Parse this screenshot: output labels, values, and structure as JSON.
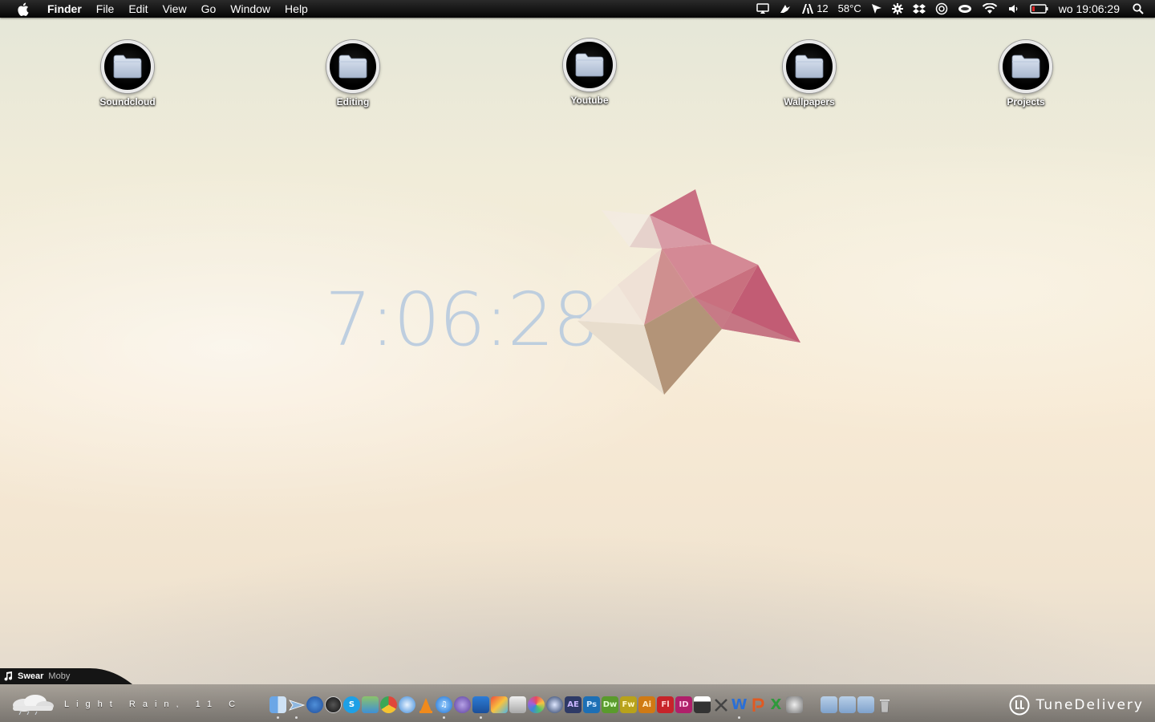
{
  "menubar": {
    "app_name": "Finder",
    "menus": [
      "File",
      "Edit",
      "View",
      "Go",
      "Window",
      "Help"
    ],
    "status": {
      "adobe_count": "12",
      "temperature": "58°C",
      "datetime": "wo 19:06:29"
    }
  },
  "desktop": {
    "folders": [
      "Soundcloud",
      "Editing",
      "Youtube",
      "Wallpapers",
      "Projects"
    ],
    "clock": "7:06:28"
  },
  "now_playing": {
    "track": "Swear",
    "artist": "Moby"
  },
  "weather": {
    "text": "Light Rain, 11 C"
  },
  "dock": {
    "labels": {
      "ae": "AE",
      "ps": "Ps",
      "dw": "Dw",
      "fw": "Fw",
      "ai": "Ai",
      "fl": "Fl",
      "id": "ID",
      "word": "W",
      "excel": "X"
    }
  },
  "brand": {
    "name": "TuneDelivery"
  },
  "colors": {
    "menubar": "#000000",
    "clock": "#b4c8de",
    "shape_pink": "#c4667a"
  }
}
